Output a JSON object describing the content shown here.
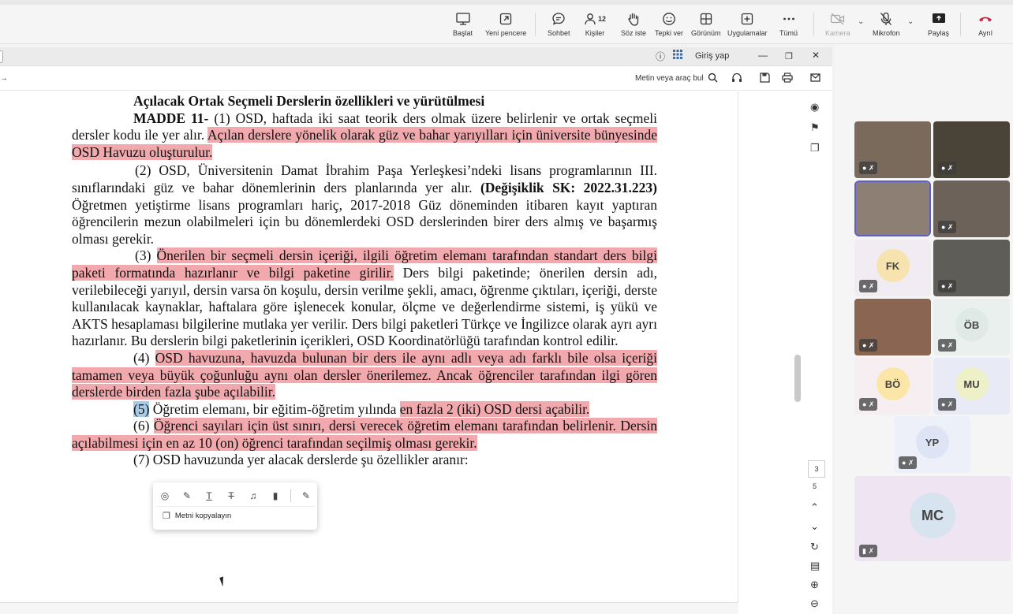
{
  "teams_toolbar": {
    "start": "Başlat",
    "new_window": "Yeni pencere",
    "chat": "Sohbet",
    "people": "Kişiler",
    "people_count": "12",
    "raise_hand": "Söz iste",
    "react": "Tepki ver",
    "view": "Görünüm",
    "apps": "Uygulamalar",
    "more": "Tümü",
    "camera": "Kamera",
    "mic": "Mikrofon",
    "share": "Paylaş",
    "leave": "Ayrıl"
  },
  "viewer": {
    "sign_in": "Giriş yap",
    "search_tools": "Metin veya araç bul",
    "page_current": "3",
    "page_total": "5"
  },
  "document": {
    "heading": "Açılacak Ortak Seçmeli Derslerin özellikleri ve yürütülmesi",
    "madde": "MADDE 11-",
    "p1_a": " (1) OSD, haftada iki saat teorik ders olmak üzere belirlenir ve ortak seçmeli dersler kodu ile yer alır. ",
    "p1_hl": "Açılan derslere yönelik olarak güz ve bahar yarıyılları için üniversite bünyesinde OSD Havuzu oluşturulur.",
    "p2_a": "(2) OSD, Üniversitenin Damat İbrahim Paşa Yerleşkesi’ndeki lisans programlarının III. sınıflarındaki güz ve bahar dönemlerinin ders planlarında yer alır. ",
    "p2_bold": "(Değişiklik SK: 2022.31.223)",
    "p2_b": " Öğretmen yetiştirme lisans programları hariç, 2017-2018 Güz döneminden itibaren kayıt yaptıran öğrencilerin mezun olabilmeleri için bu dönemlerdeki OSD derslerinden birer ders almış ve başarmış olması gerekir.",
    "p3_num": "(3) ",
    "p3_hl": "Önerilen bir seçmeli dersin içeriği, ilgili öğretim elemanı tarafından standart ders bilgi paketi formatında hazırlanır ve bilgi paketine girilir.",
    "p3_b": " Ders bilgi paketinde; önerilen dersin adı, verilebileceği yarıyıl, dersin varsa ön koşulu, dersin verilme şekli, amacı, öğrenme çıktıları, içeriği, derste kullanılacak kaynaklar, haftalara göre işlenecek konular, ölçme ve değerlendirme sistemi, iş yükü ve AKTS hesaplaması bilgilerine mutlaka yer verilir. Ders bilgi paketleri Türkçe ve İngilizce olarak ayrı ayrı hazırlanır. Bu derslerin bilgi paketlerinin içerikleri, OSD Koordinatörlüğü tarafından kontrol edilir.",
    "p4_num": "(4) ",
    "p4_hl": "OSD havuzuna, havuzda bulunan bir ders ile aynı adlı veya adı farklı bile olsa içeriği tamamen veya büyük çoğunluğu aynı olan dersler önerilemez. Ancak öğrenciler tarafından ilgi gören derslerde birden fazla şube açılabilir.",
    "p5_sel": "(5)",
    "p5_a": " Öğretim elemanı, bir eğitim-öğretim yılında ",
    "p5_hl": "en fazla 2 (iki) OSD dersi açabilir.",
    "p6_num": "(6) ",
    "p6_hl": "Öğrenci sayıları için üst sınırı, dersi verecek öğretim elemanı tarafından belirlenir. Dersin açılabilmesi için en az 10 (on) öğrenci tarafından seçilmiş olması gerekir.",
    "p7": "(7) OSD havuzunda yer alacak derslerde şu özellikler aranır:"
  },
  "float_toolbar": {
    "copy_text": "Metni kopyalayın"
  },
  "participants": [
    {
      "initials": "",
      "kind": "video"
    },
    {
      "initials": "",
      "kind": "video"
    },
    {
      "initials": "",
      "kind": "video"
    },
    {
      "initials": "",
      "kind": "video"
    },
    {
      "initials": "FK",
      "kind": "avatar"
    },
    {
      "initials": "",
      "kind": "video"
    },
    {
      "initials": "",
      "kind": "video"
    },
    {
      "initials": "ÖB",
      "kind": "avatar"
    },
    {
      "initials": "BÖ",
      "kind": "avatar"
    },
    {
      "initials": "MU",
      "kind": "avatar"
    },
    {
      "initials": "YP",
      "kind": "avatar"
    },
    {
      "initials": "MC",
      "kind": "avatar"
    }
  ],
  "colors": {
    "highlight": "#f1a9ae",
    "selection": "#a6cbe8",
    "leave": "#c4314b",
    "accent": "#5b5fc7"
  }
}
